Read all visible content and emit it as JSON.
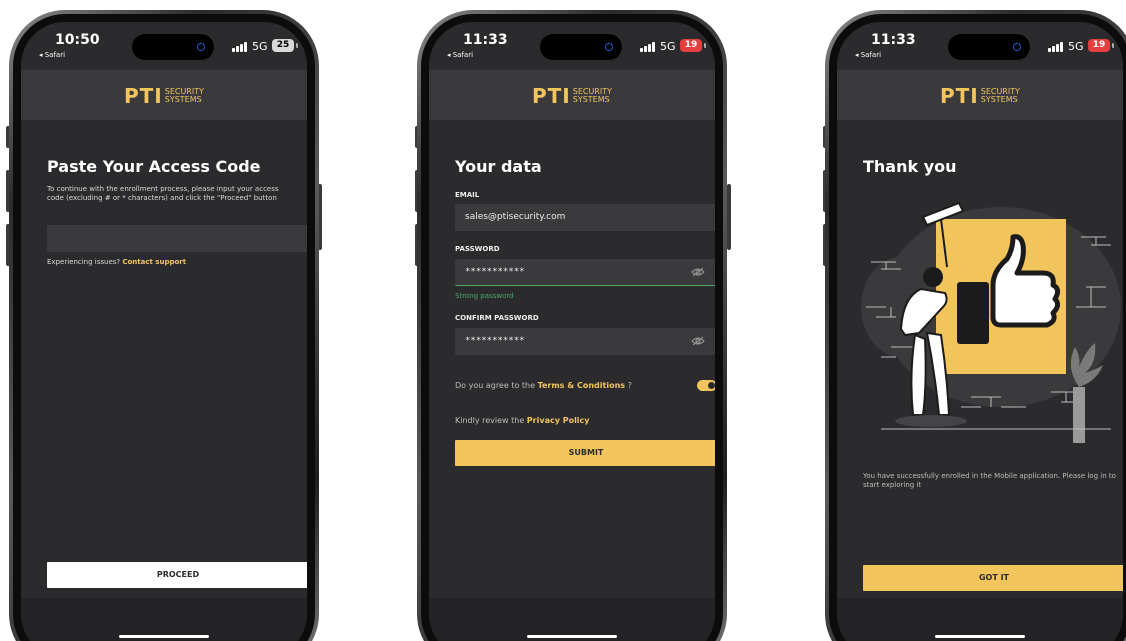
{
  "brand": {
    "name": "PTI",
    "sub_top": "SECURITY",
    "sub_bottom": "SYSTEMS"
  },
  "screens": [
    {
      "status": {
        "time": "10:50",
        "carrier": "◂ Safari",
        "network": "5G",
        "battery": "25"
      },
      "title": "Paste Your Access Code",
      "description": "To continue with the enrollment process, please input your access code (excluding # or * characters) and click the \"Proceed\" button",
      "code_value": "",
      "issues_text": "Experiencing issues?",
      "support_link": "Contact support",
      "proceed_label": "PROCEED"
    },
    {
      "status": {
        "time": "11:33",
        "carrier": "◂ Safari",
        "network": "5G",
        "battery": "19"
      },
      "title": "Your data",
      "email_label": "EMAIL",
      "email_value": "sales@ptisecurity.com",
      "password_label": "PASSWORD",
      "password_value": "***********",
      "strength": "Strong password",
      "confirm_label": "CONFIRM PASSWORD",
      "confirm_value": "***********",
      "terms_prefix": "Do you agree to the",
      "terms_link": "Terms & Conditions",
      "terms_suffix": "?",
      "privacy_prefix": "Kindly review the",
      "privacy_link": "Privacy Policy",
      "submit_label": "SUBMIT"
    },
    {
      "status": {
        "time": "11:33",
        "carrier": "◂ Safari",
        "network": "5G",
        "battery": "19"
      },
      "title": "Thank you",
      "message": "You have successfully enrolled in the Mobile application. Please log in to start exploring it",
      "got_it_label": "GOT IT"
    }
  ],
  "colors": {
    "accent": "#f2c45c",
    "screen_bg": "#2b2b2e",
    "field_bg": "#3a3a3d",
    "success": "#4ca86a",
    "battery_low": "#e43f3f"
  }
}
